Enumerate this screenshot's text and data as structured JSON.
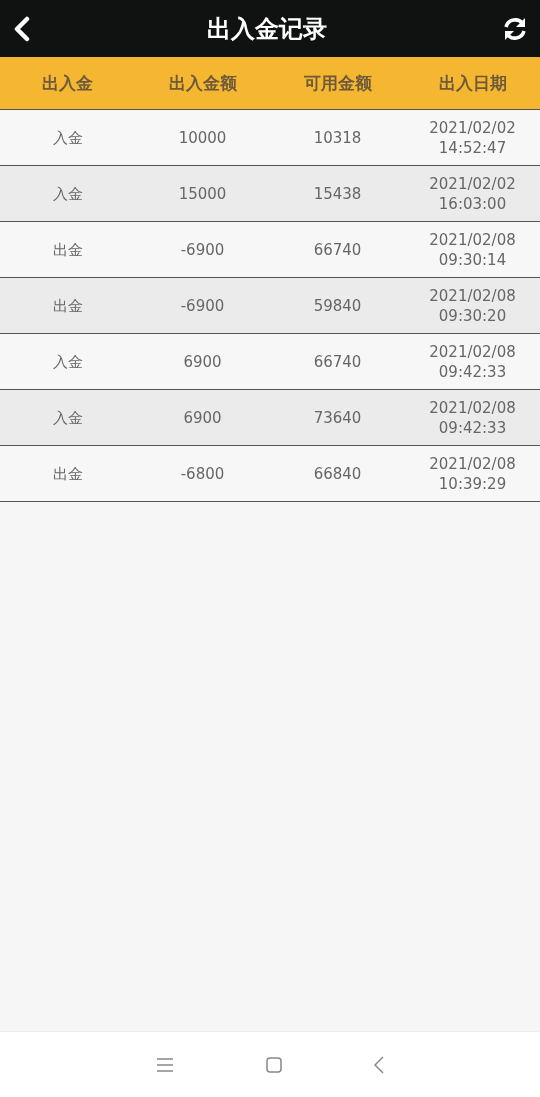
{
  "header": {
    "title": "出入金记录"
  },
  "table": {
    "columns": [
      "出入金",
      "出入金额",
      "可用金额",
      "出入日期"
    ],
    "rows": [
      {
        "type": "入金",
        "amount": "10000",
        "available": "10318",
        "date": "2021/02/02",
        "time": "14:52:47"
      },
      {
        "type": "入金",
        "amount": "15000",
        "available": "15438",
        "date": "2021/02/02",
        "time": "16:03:00"
      },
      {
        "type": "出金",
        "amount": "-6900",
        "available": "66740",
        "date": "2021/02/08",
        "time": "09:30:14"
      },
      {
        "type": "出金",
        "amount": "-6900",
        "available": "59840",
        "date": "2021/02/08",
        "time": "09:30:20"
      },
      {
        "type": "入金",
        "amount": "6900",
        "available": "66740",
        "date": "2021/02/08",
        "time": "09:42:33"
      },
      {
        "type": "入金",
        "amount": "6900",
        "available": "73640",
        "date": "2021/02/08",
        "time": "09:42:33"
      },
      {
        "type": "出金",
        "amount": "-6800",
        "available": "66840",
        "date": "2021/02/08",
        "time": "10:39:29"
      }
    ]
  }
}
